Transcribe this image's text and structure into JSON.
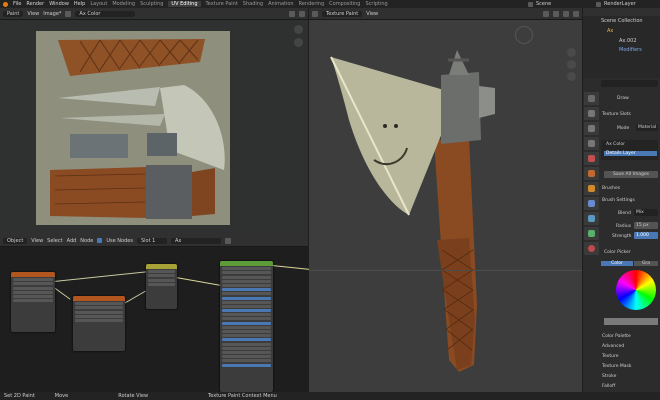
{
  "topbar": {
    "menus": [
      "File",
      "Render",
      "Window",
      "Help"
    ],
    "workspaces": [
      "Layout",
      "Modeling",
      "Sculpting",
      "UV Editing",
      "Texture Paint",
      "Shading",
      "Animation",
      "Rendering",
      "Compositing",
      "Scripting"
    ],
    "active_workspace": "UV Editing",
    "scene": "Scene",
    "view_layer": "RenderLayer"
  },
  "image_editor": {
    "mode": "Paint",
    "view": "View",
    "image": "Image*",
    "image_name": "Ax Color"
  },
  "viewport": {
    "mode": "Texture Paint",
    "view": "View"
  },
  "node_editor": {
    "object": "Object",
    "menus": [
      "View",
      "Select",
      "Add",
      "Node"
    ],
    "use_nodes": "Use Nodes",
    "slot": "Slot 1",
    "material": "Ax"
  },
  "outliner": {
    "scene_collection": "Scene Collection",
    "items": [
      "Ax",
      "Ax.002",
      "Modifiers"
    ]
  },
  "properties": {
    "brush": "Draw",
    "texture_slots": "Texture Slots",
    "mode_label": "Mode",
    "mode_value": "Material",
    "slots": [
      "Ax Color",
      "Details Layer"
    ],
    "save_all": "Save All Images",
    "brushes": "Brushes",
    "brush_settings": "Brush Settings",
    "blend_label": "Blend",
    "blend_value": "Mix",
    "radius_label": "Radius",
    "radius_value": "15 px",
    "strength_label": "Strength",
    "strength_value": "1.000",
    "color_picker": "Color Picker",
    "color_tab": "Color",
    "gradient_tab": "Gra",
    "sections": [
      "Color Palette",
      "Advanced",
      "Texture",
      "Texture Mask",
      "Stroke",
      "Falloff"
    ]
  },
  "statusbar": {
    "left": "Set 2D Paint",
    "mid": "Move",
    "right": "Rotate View",
    "context": "Texture Paint Context Menu"
  },
  "colors": {
    "header_active": "#3d3d3d",
    "accent_blue": "#4a78b5",
    "node_orange": "#b0561e",
    "node_yellow": "#a7a236",
    "node_green": "#5e9c3a"
  }
}
